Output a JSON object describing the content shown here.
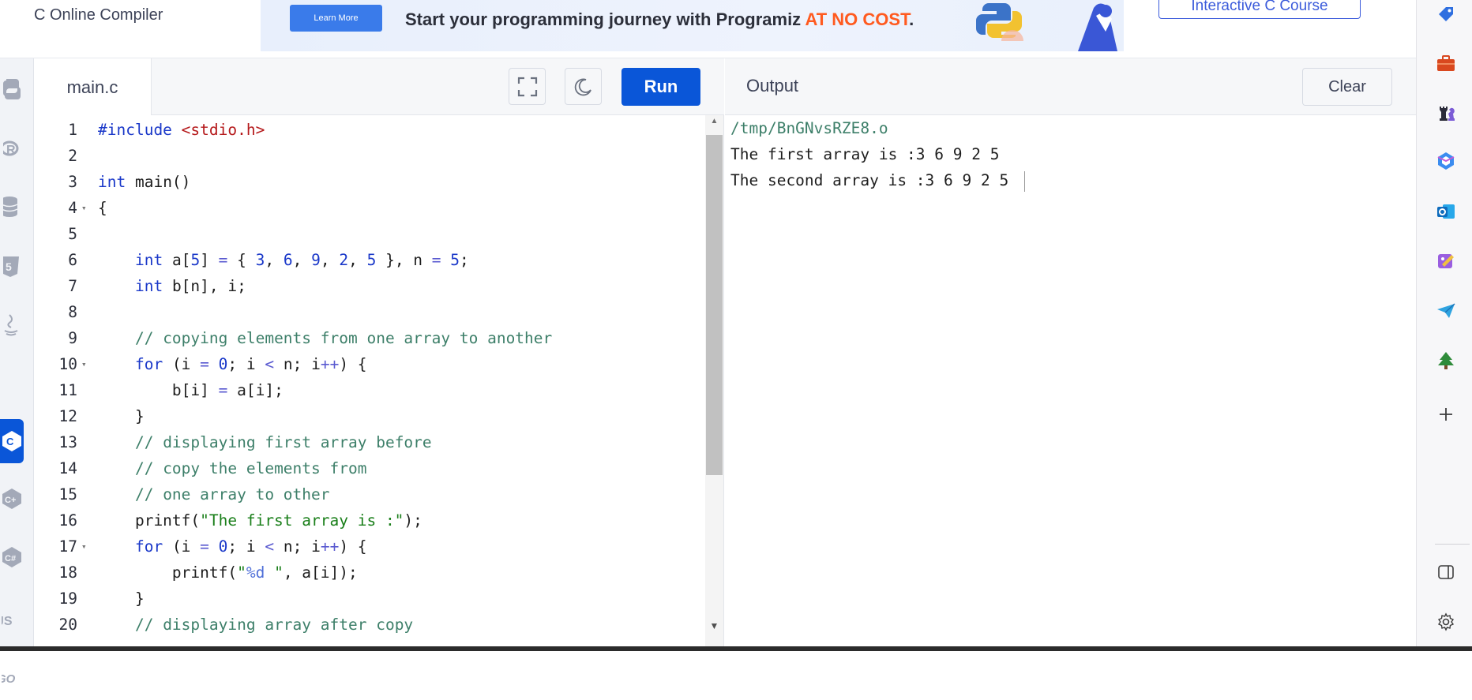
{
  "header": {
    "site_title": "C Online Compiler",
    "banner_button": "Learn More",
    "banner_text": "Start your programming journey with Programiz ",
    "banner_highlight": "AT NO COST",
    "banner_suffix": ".",
    "course_button": "Interactive C Course"
  },
  "editor": {
    "file_name": "main.c",
    "run_label": "Run"
  },
  "output": {
    "title": "Output",
    "clear_label": "Clear",
    "lines": [
      "/tmp/BnGNvsRZE8.o",
      "The first array is :3 6 9 2 5 ",
      "The second array is :3 6 9 2 5 "
    ]
  },
  "code_lines": [
    {
      "n": "1",
      "fold": false
    },
    {
      "n": "2",
      "fold": false
    },
    {
      "n": "3",
      "fold": false
    },
    {
      "n": "4",
      "fold": true
    },
    {
      "n": "5",
      "fold": false
    },
    {
      "n": "6",
      "fold": false
    },
    {
      "n": "7",
      "fold": false
    },
    {
      "n": "8",
      "fold": false
    },
    {
      "n": "9",
      "fold": false
    },
    {
      "n": "10",
      "fold": true
    },
    {
      "n": "11",
      "fold": false
    },
    {
      "n": "12",
      "fold": false
    },
    {
      "n": "13",
      "fold": false
    },
    {
      "n": "14",
      "fold": false
    },
    {
      "n": "15",
      "fold": false
    },
    {
      "n": "16",
      "fold": false
    },
    {
      "n": "17",
      "fold": true
    },
    {
      "n": "18",
      "fold": false
    },
    {
      "n": "19",
      "fold": false
    },
    {
      "n": "20",
      "fold": false
    }
  ],
  "code_tokens": [
    [
      [
        "inc-kw",
        "#include "
      ],
      [
        "inc",
        "<stdio.h>"
      ]
    ],
    [],
    [
      [
        "kw",
        "int"
      ],
      [
        "p",
        " main()"
      ]
    ],
    [
      [
        "p",
        "{"
      ]
    ],
    [],
    [
      [
        "p",
        "    "
      ],
      [
        "kw",
        "int"
      ],
      [
        "p",
        " a["
      ],
      [
        "num",
        "5"
      ],
      [
        "p",
        "] "
      ],
      [
        "op",
        "="
      ],
      [
        "p",
        " { "
      ],
      [
        "num",
        "3"
      ],
      [
        "p",
        ", "
      ],
      [
        "num",
        "6"
      ],
      [
        "p",
        ", "
      ],
      [
        "num",
        "9"
      ],
      [
        "p",
        ", "
      ],
      [
        "num",
        "2"
      ],
      [
        "p",
        ", "
      ],
      [
        "num",
        "5"
      ],
      [
        "p",
        " }, n "
      ],
      [
        "op",
        "="
      ],
      [
        "p",
        " "
      ],
      [
        "num",
        "5"
      ],
      [
        "p",
        ";"
      ]
    ],
    [
      [
        "p",
        "    "
      ],
      [
        "kw",
        "int"
      ],
      [
        "p",
        " b[n], i;"
      ]
    ],
    [],
    [
      [
        "p",
        "    "
      ],
      [
        "cmt",
        "// copying elements from one array to another"
      ]
    ],
    [
      [
        "p",
        "    "
      ],
      [
        "kw",
        "for"
      ],
      [
        "p",
        " (i "
      ],
      [
        "op",
        "="
      ],
      [
        "p",
        " "
      ],
      [
        "num",
        "0"
      ],
      [
        "p",
        "; i "
      ],
      [
        "op",
        "<"
      ],
      [
        "p",
        " n; i"
      ],
      [
        "op",
        "++"
      ],
      [
        "p",
        ") {"
      ]
    ],
    [
      [
        "p",
        "        b[i] "
      ],
      [
        "op",
        "="
      ],
      [
        "p",
        " a[i];"
      ]
    ],
    [
      [
        "p",
        "    }"
      ]
    ],
    [
      [
        "p",
        "    "
      ],
      [
        "cmt",
        "// displaying first array before"
      ]
    ],
    [
      [
        "p",
        "    "
      ],
      [
        "cmt",
        "// copy the elements from"
      ]
    ],
    [
      [
        "p",
        "    "
      ],
      [
        "cmt",
        "// one array to other"
      ]
    ],
    [
      [
        "p",
        "    printf("
      ],
      [
        "str",
        "\"The first array is :\""
      ],
      [
        "p",
        ");"
      ]
    ],
    [
      [
        "p",
        "    "
      ],
      [
        "kw",
        "for"
      ],
      [
        "p",
        " (i "
      ],
      [
        "op",
        "="
      ],
      [
        "p",
        " "
      ],
      [
        "num",
        "0"
      ],
      [
        "p",
        "; i "
      ],
      [
        "op",
        "<"
      ],
      [
        "p",
        " n; i"
      ],
      [
        "op",
        "++"
      ],
      [
        "p",
        ") {"
      ]
    ],
    [
      [
        "p",
        "        printf("
      ],
      [
        "str",
        "\""
      ],
      [
        "fmt",
        "%d"
      ],
      [
        "str",
        " \""
      ],
      [
        "p",
        ", a[i]);"
      ]
    ],
    [
      [
        "p",
        "    }"
      ]
    ],
    [
      [
        "p",
        "    "
      ],
      [
        "cmt",
        "// displaying array after copy"
      ]
    ]
  ],
  "languages": [
    "python-icon",
    "r-icon",
    "sql-icon",
    "html-icon",
    "java-icon",
    "c-icon",
    "cpp-icon",
    "csharp-icon",
    "js-icon",
    "go-icon"
  ],
  "right_sidebar": [
    "tag-icon",
    "briefcase-icon",
    "chess-icon",
    "copilot-icon",
    "outlook-icon",
    "designer-icon",
    "send-icon",
    "tree-icon",
    "plus-icon",
    "sidebar-toggle-icon",
    "settings-icon"
  ],
  "colors": {
    "accent": "#0a56d8",
    "highlight": "#ff5a1f",
    "keyword": "#1a38c9",
    "string": "#1a7f1a",
    "comment": "#3d7f69",
    "include": "#b5191b"
  }
}
